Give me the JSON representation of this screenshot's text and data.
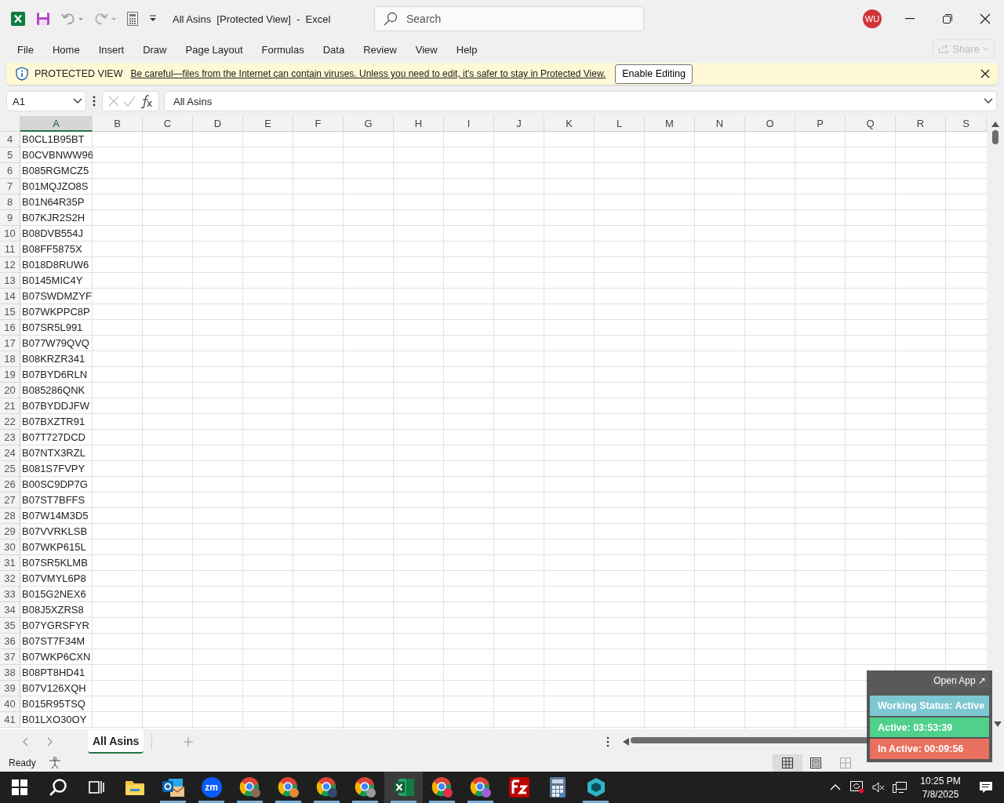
{
  "title_bar": {
    "title": "All Asins  [Protected View]  -  Excel",
    "search_placeholder": "Search",
    "avatar": "WU"
  },
  "ribbon": {
    "tabs": [
      "File",
      "Home",
      "Insert",
      "Draw",
      "Page Layout",
      "Formulas",
      "Data",
      "Review",
      "View",
      "Help"
    ],
    "share": {
      "label": "Share",
      "disabled": true
    }
  },
  "protected_view": {
    "label": "PROTECTED VIEW",
    "message": "Be careful—files from the Internet can contain viruses. Unless you need to edit, it's safer to stay in Protected View.",
    "button": "Enable Editing"
  },
  "formula_bar": {
    "name_box": "A1",
    "value": "All Asins"
  },
  "columns": [
    {
      "label": "A",
      "selected": true
    },
    {
      "label": "B",
      "selected": false
    },
    {
      "label": "C",
      "selected": false
    },
    {
      "label": "D",
      "selected": false
    },
    {
      "label": "E",
      "selected": false
    },
    {
      "label": "F",
      "selected": false
    },
    {
      "label": "G",
      "selected": false
    },
    {
      "label": "H",
      "selected": false
    },
    {
      "label": "I",
      "selected": false
    },
    {
      "label": "J",
      "selected": false
    },
    {
      "label": "K",
      "selected": false
    },
    {
      "label": "L",
      "selected": false
    },
    {
      "label": "M",
      "selected": false
    },
    {
      "label": "N",
      "selected": false
    },
    {
      "label": "O",
      "selected": false
    },
    {
      "label": "P",
      "selected": false
    },
    {
      "label": "Q",
      "selected": false
    },
    {
      "label": "R",
      "selected": false
    },
    {
      "label": "S",
      "selected": false
    }
  ],
  "rows": [
    {
      "number": "4",
      "a": "B0CL1B95BT"
    },
    {
      "number": "5",
      "a": "B0CVBNWW96"
    },
    {
      "number": "6",
      "a": "B085RGMCZ5"
    },
    {
      "number": "7",
      "a": "B01MQJZO8S"
    },
    {
      "number": "8",
      "a": "B01N64R35P"
    },
    {
      "number": "9",
      "a": "B07KJR2S2H"
    },
    {
      "number": "10",
      "a": "B08DVB554J"
    },
    {
      "number": "11",
      "a": "B08FF5875X"
    },
    {
      "number": "12",
      "a": "B018D8RUW6"
    },
    {
      "number": "13",
      "a": "B0145MIC4Y"
    },
    {
      "number": "14",
      "a": "B07SWDMZYF"
    },
    {
      "number": "15",
      "a": "B07WKPPC8P"
    },
    {
      "number": "16",
      "a": "B07SR5L991"
    },
    {
      "number": "17",
      "a": "B077W79QVQ"
    },
    {
      "number": "18",
      "a": "B08KRZR341"
    },
    {
      "number": "19",
      "a": "B07BYD6RLN"
    },
    {
      "number": "20",
      "a": "B085286QNK"
    },
    {
      "number": "21",
      "a": "B07BYDDJFW"
    },
    {
      "number": "22",
      "a": "B07BXZTR91"
    },
    {
      "number": "23",
      "a": "B07T727DCD"
    },
    {
      "number": "24",
      "a": "B07NTX3RZL"
    },
    {
      "number": "25",
      "a": "B081S7FVPY"
    },
    {
      "number": "26",
      "a": "B00SC9DP7G"
    },
    {
      "number": "27",
      "a": "B07ST7BFFS"
    },
    {
      "number": "28",
      "a": "B07W14M3D5"
    },
    {
      "number": "29",
      "a": "B07VVRKLSB"
    },
    {
      "number": "30",
      "a": "B07WKP615L"
    },
    {
      "number": "31",
      "a": "B07SR5KLMB"
    },
    {
      "number": "32",
      "a": "B07VMYL6P8"
    },
    {
      "number": "33",
      "a": "B015G2NEX6"
    },
    {
      "number": "34",
      "a": "B08J5XZRS8"
    },
    {
      "number": "35",
      "a": "B07YGRSFYR"
    },
    {
      "number": "36",
      "a": "B07ST7F34M"
    },
    {
      "number": "37",
      "a": "B07WKP6CXN"
    },
    {
      "number": "38",
      "a": "B08PT8HD41"
    },
    {
      "number": "39",
      "a": "B07V126XQH"
    },
    {
      "number": "40",
      "a": "B015R95TSQ"
    },
    {
      "number": "41",
      "a": "B01LXO30OY"
    }
  ],
  "sheet_tabs": [
    {
      "label": "All Asins",
      "selected": true
    }
  ],
  "status_bar": {
    "status": "Ready",
    "views": [
      {
        "kind": "normal",
        "selected": true
      },
      {
        "kind": "page-layout",
        "selected": false
      },
      {
        "kind": "page-break",
        "selected": false
      }
    ]
  },
  "tracker_widget": {
    "open_app": "Open App ↗",
    "items": [
      {
        "label": "Working Status: Active",
        "color": "#7cc7d1"
      },
      {
        "label": "Active: 03:53:39",
        "color": "#4fd08c"
      },
      {
        "label": "In Active: 00:09:56",
        "color": "#e9705f"
      }
    ]
  },
  "taskbar": {
    "apps": [
      {
        "kind": "start",
        "running": false,
        "active": false
      },
      {
        "kind": "search",
        "running": false,
        "active": false
      },
      {
        "kind": "task-view",
        "running": false,
        "active": false
      },
      {
        "kind": "folder",
        "running": false,
        "active": false
      },
      {
        "kind": "mail",
        "running": true,
        "active": false
      },
      {
        "kind": "zoom",
        "label": "zm",
        "running": true,
        "active": false
      },
      {
        "kind": "browser",
        "color": "#8a6a55",
        "running": true,
        "active": false
      },
      {
        "kind": "browser",
        "color": "#e58a3a",
        "running": true,
        "active": false
      },
      {
        "kind": "browser",
        "color": "#2f4a70",
        "running": true,
        "active": false
      },
      {
        "kind": "browser",
        "color": "#9a9a9a",
        "running": true,
        "active": false
      },
      {
        "kind": "spreadsheet",
        "running": true,
        "active": true
      },
      {
        "kind": "browser",
        "color": "#e0304a",
        "running": true,
        "active": false
      },
      {
        "kind": "browser",
        "color": "#a060d0",
        "running": true,
        "active": false
      },
      {
        "kind": "ftp",
        "running": false,
        "active": false
      },
      {
        "kind": "calculator",
        "running": false,
        "active": false
      },
      {
        "kind": "cube",
        "running": true,
        "active": false
      }
    ],
    "time": "10:25 PM",
    "date": "7/8/2025"
  }
}
